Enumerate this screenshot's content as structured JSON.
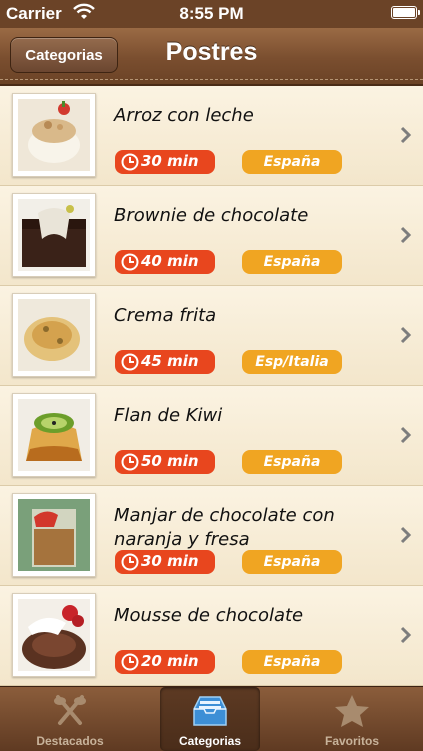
{
  "status_bar": {
    "carrier": "Carrier",
    "time": "8:55 PM"
  },
  "nav": {
    "back_label": "Categorias",
    "title": "Postres"
  },
  "recipes": [
    {
      "title": "Arroz con leche",
      "time": "30 min",
      "country": "España"
    },
    {
      "title": "Brownie de chocolate",
      "time": "40 min",
      "country": "España"
    },
    {
      "title": "Crema frita",
      "time": "45 min",
      "country": "Esp/Italia"
    },
    {
      "title": "Flan de Kiwi",
      "time": "50 min",
      "country": "España"
    },
    {
      "title": "Manjar de chocolate con naranja y fresa",
      "time": "30 min",
      "country": "España"
    },
    {
      "title": "Mousse de chocolate",
      "time": "20 min",
      "country": "España"
    }
  ],
  "tabs": [
    {
      "label": "Destacados",
      "icon": "utensils-icon",
      "active": false
    },
    {
      "label": "Categorias",
      "icon": "tray-icon",
      "active": true
    },
    {
      "label": "Favoritos",
      "icon": "star-icon",
      "active": false
    }
  ],
  "colors": {
    "time_badge": "#e8461e",
    "country_badge": "#f0a522",
    "leather": "#7a4e2f"
  }
}
